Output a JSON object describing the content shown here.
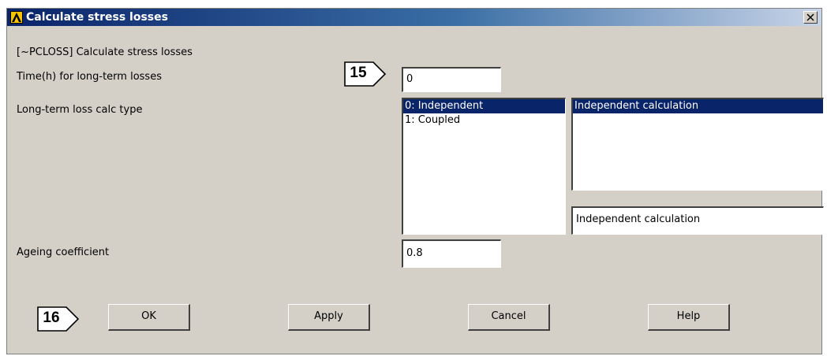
{
  "window": {
    "title": "Calculate stress losses"
  },
  "header": {
    "command_label": "[~PCLOSS] Calculate stress losses"
  },
  "time_field": {
    "label": "Time(h) for long-term losses",
    "value": "0"
  },
  "loss_type": {
    "label": "Long-term loss calc type",
    "options": [
      "0: Independent",
      "1: Coupled"
    ],
    "selected_index": 0,
    "description_list": [
      "Independent calculation"
    ],
    "selected_value": "Independent calculation"
  },
  "ageing_field": {
    "label": "Ageing coefficient",
    "value": "0.8"
  },
  "buttons": {
    "ok": "OK",
    "apply": "Apply",
    "cancel": "Cancel",
    "help": "Help"
  },
  "callouts": {
    "step_15": "15",
    "step_16": "16"
  },
  "colors": {
    "selection": "#0a246a",
    "dialog_bg": "#d4d0c8"
  }
}
